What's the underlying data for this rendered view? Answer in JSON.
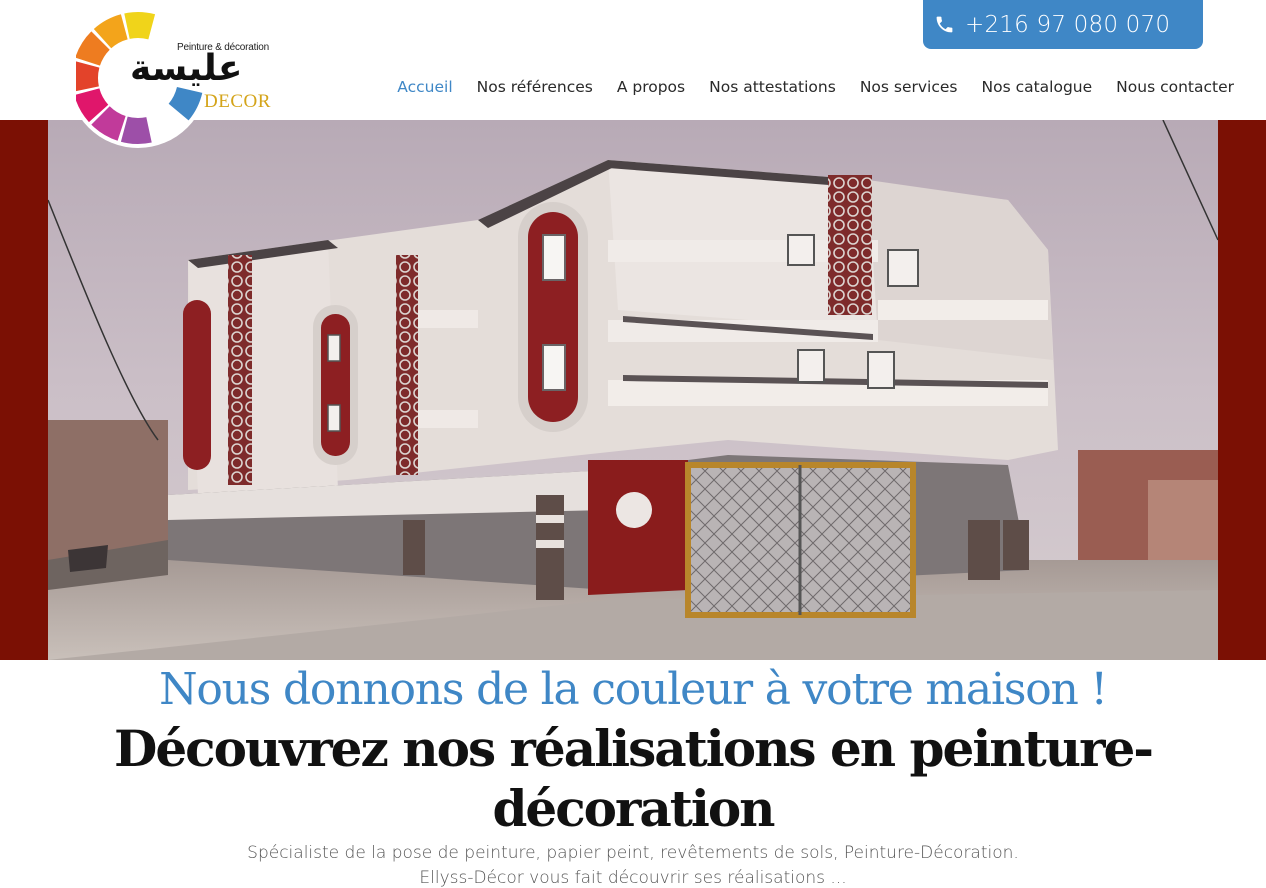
{
  "header": {
    "logo": {
      "tagline": "Peinture & décoration",
      "arabic_name": "عليسة",
      "decor": "DECOR",
      "wheel_colors": [
        "#f0d41a",
        "#f3a41b",
        "#ee7c20",
        "#e3432a",
        "#e0166b",
        "#c13a9a",
        "#9d4fa8",
        "#3f87c6"
      ]
    },
    "phone": {
      "icon": "phone-icon",
      "number": "+216 97 080 070"
    },
    "nav": [
      {
        "label": "Accueil",
        "active": true
      },
      {
        "label": "Nos références",
        "active": false
      },
      {
        "label": "A propos",
        "active": false
      },
      {
        "label": "Nos attestations",
        "active": false
      },
      {
        "label": "Nos services",
        "active": false
      },
      {
        "label": "Nos catalogue",
        "active": false
      },
      {
        "label": "Nous contacter",
        "active": false
      }
    ]
  },
  "hero": {
    "photo_subject": "building-facade-photo",
    "frame_color": "#7b1004"
  },
  "main": {
    "tagline": "Nous donnons de la couleur à votre maison !",
    "title": "Découvrez nos réalisations en peinture-décoration",
    "description_line1": "Spécialiste de la pose de peinture, papier peint, revêtements de sols, Peinture-Décoration.",
    "description_line2": "Ellyss-Décor vous fait découvrir ses réalisations ..."
  },
  "colors": {
    "accent": "#3f87c6",
    "text": "#111111"
  }
}
